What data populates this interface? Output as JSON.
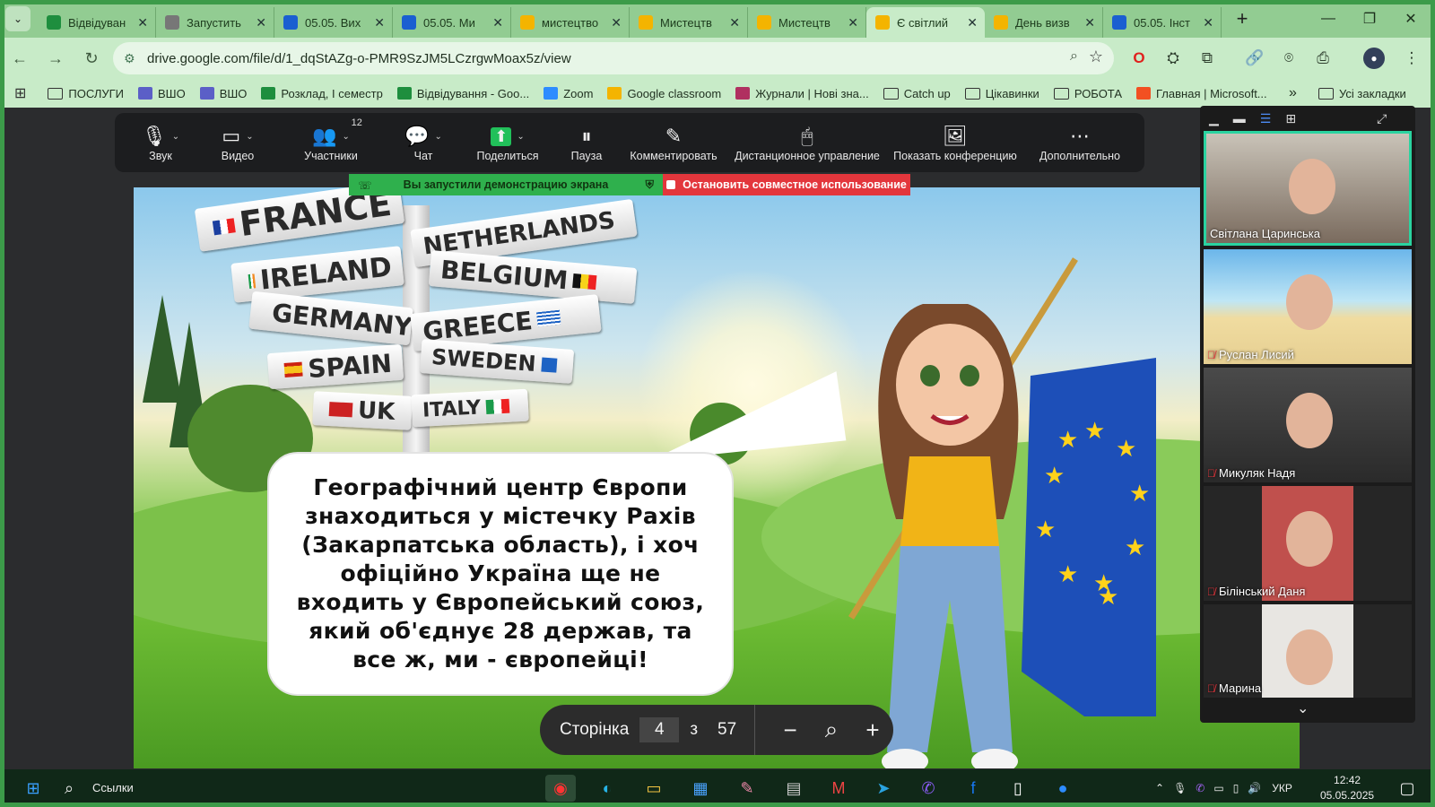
{
  "browser": {
    "tabs": [
      {
        "label": "Відвідуван",
        "icon": "sheets-icon",
        "color": "#1e8e3e"
      },
      {
        "label": "Запустить",
        "icon": "globe-icon",
        "color": "#777777"
      },
      {
        "label": "05.05. Вих",
        "icon": "contacts-icon",
        "color": "#1a5fd1"
      },
      {
        "label": "05.05. Ми",
        "icon": "contacts-icon",
        "color": "#1a5fd1"
      },
      {
        "label": "мистецтво",
        "icon": "drive-icon",
        "color": "#f4b400"
      },
      {
        "label": "Мистецтв",
        "icon": "slides-icon",
        "color": "#f4b400"
      },
      {
        "label": "Мистецтв",
        "icon": "slides-icon",
        "color": "#f4b400"
      },
      {
        "label": "Є світлий",
        "icon": "drive-icon",
        "color": "#f4b400"
      },
      {
        "label": "День визв",
        "icon": "drive-icon",
        "color": "#f4b400"
      },
      {
        "label": "05.05. Інст",
        "icon": "contacts-icon",
        "color": "#1a5fd1"
      }
    ],
    "active_tab": 7,
    "url": "drive.google.com/file/d/1_dqStAZg-o-PMR9SzJM5LCzrgwMoax5z/view",
    "bookmarks": [
      {
        "label": "ПОСЛУГИ",
        "icon": "folder"
      },
      {
        "label": "ВШО",
        "icon": "teams"
      },
      {
        "label": "ВШО",
        "icon": "teams"
      },
      {
        "label": "Розклад, I семестр",
        "icon": "sheets"
      },
      {
        "label": "Відвідування - Goo...",
        "icon": "sheets"
      },
      {
        "label": "Zoom",
        "icon": "zoom"
      },
      {
        "label": "Google classroom",
        "icon": "classroom"
      },
      {
        "label": "Журнали | Нові зна...",
        "icon": "journal"
      },
      {
        "label": "Catch up",
        "icon": "folder"
      },
      {
        "label": "Цікавинки",
        "icon": "folder"
      },
      {
        "label": "РОБОТА",
        "icon": "folder"
      },
      {
        "label": "Главная | Microsoft...",
        "icon": "microsoft"
      }
    ],
    "all_bookmarks": "Усі закладки"
  },
  "zoom": {
    "controls": [
      {
        "label": "Звук",
        "icon": "microphone-icon",
        "glyph": "🎙",
        "caret": true
      },
      {
        "label": "Видео",
        "icon": "video-camera-icon",
        "glyph": "▭",
        "caret": true
      },
      {
        "label": "Участники",
        "icon": "participants-icon",
        "glyph": "👥",
        "caret": true,
        "count": "12"
      },
      {
        "label": "Чат",
        "icon": "chat-icon",
        "glyph": "💬",
        "caret": true
      },
      {
        "label": "Поделиться",
        "icon": "share-screen-icon",
        "glyph": "⬆",
        "caret": true
      },
      {
        "label": "Пауза",
        "icon": "pause-icon",
        "glyph": "⏸",
        "caret": false
      },
      {
        "label": "Комментировать",
        "icon": "annotate-pencil-icon",
        "glyph": "✎",
        "caret": false
      },
      {
        "label": "Дистанционное управление",
        "icon": "mouse-icon",
        "glyph": "🖱",
        "caret": false
      },
      {
        "label": "Показать конференцию",
        "icon": "show-meeting-icon",
        "glyph": "🖼",
        "caret": false
      },
      {
        "label": "Дополнительно",
        "icon": "more-icon",
        "glyph": "⋯",
        "caret": false
      }
    ],
    "share_status": "Вы запустили демонстрацию экрана",
    "stop_share": "Остановить совместное использование",
    "participants": [
      {
        "name": "Світлана Царинська",
        "muted": false,
        "speaking": true
      },
      {
        "name": "Руслан Лисий",
        "muted": true,
        "speaking": false
      },
      {
        "name": "Микуляк Надя",
        "muted": true,
        "speaking": false
      },
      {
        "name": "Білінський Даня",
        "muted": true,
        "speaking": false
      },
      {
        "name": "Марина",
        "muted": true,
        "speaking": false
      }
    ]
  },
  "slide": {
    "signs": [
      "FRANCE",
      "NETHERLANDS",
      "IRELAND",
      "BELGIUM",
      "GERMANY",
      "GREECE",
      "SPAIN",
      "SWEDEN",
      "UK",
      "ITALY"
    ],
    "text": "Географічний центр Європи знаходиться у містечку Рахів (Закарпатська область), і хоч офіційно Україна ще не входить у Європейський союз, який об'єднує 28 держав, та все ж, ми - європейці!"
  },
  "pdf_pager": {
    "label": "Сторінка",
    "current": "4",
    "of": "з",
    "total": "57"
  },
  "taskbar": {
    "search": "Ссылки",
    "lang": "УКР",
    "time": "12:42",
    "date": "05.05.2025"
  }
}
